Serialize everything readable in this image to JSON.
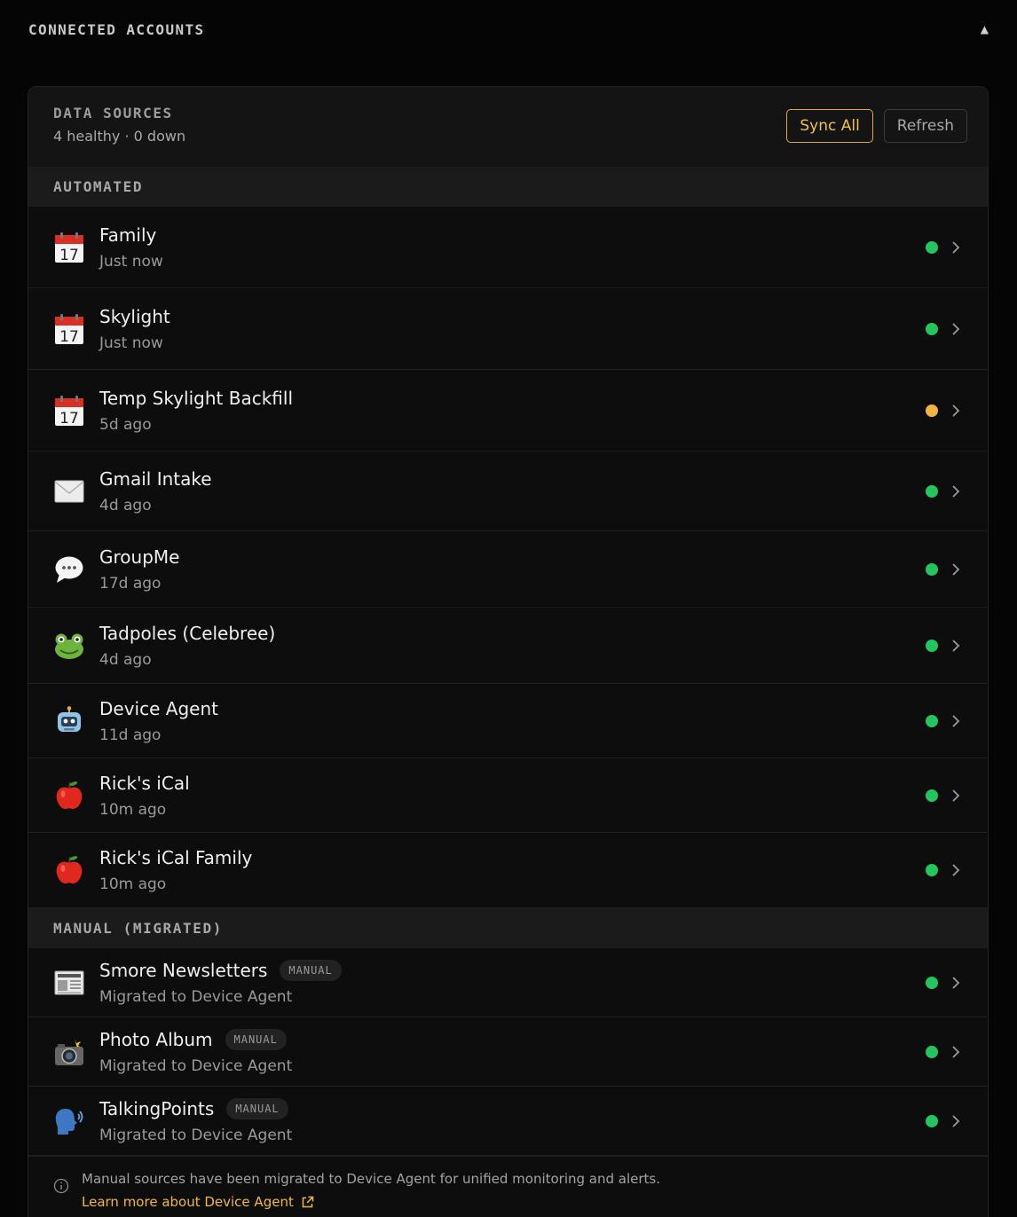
{
  "section": {
    "title": "CONNECTED ACCOUNTS",
    "caret": "▲"
  },
  "card": {
    "title": "DATA SOURCES",
    "status_summary": "4 healthy · 0 down",
    "sync_all_label": "Sync All",
    "refresh_label": "Refresh"
  },
  "colors": {
    "healthy": "#22c55e",
    "warning": "#f2b441",
    "accent": "#f0b93a"
  },
  "groups": {
    "automated_label": "AUTOMATED",
    "manual_label": "MANUAL (MIGRATED)"
  },
  "automated": [
    {
      "name": "Family",
      "meta": "Just now",
      "icon": "calendar-icon",
      "status": "healthy"
    },
    {
      "name": "Skylight",
      "meta": "Just now",
      "icon": "calendar-icon",
      "status": "healthy"
    },
    {
      "name": "Temp Skylight Backfill",
      "meta": "5d ago",
      "icon": "calendar-icon",
      "status": "warning"
    },
    {
      "name": "Gmail Intake",
      "meta": "4d ago",
      "icon": "envelope-icon",
      "status": "healthy"
    },
    {
      "name": "GroupMe",
      "meta": "17d ago",
      "icon": "speech-bubble-icon",
      "status": "healthy"
    },
    {
      "name": "Tadpoles (Celebree)",
      "meta": "4d ago",
      "icon": "frog-icon",
      "status": "healthy"
    },
    {
      "name": "Device Agent",
      "meta": "11d ago",
      "icon": "robot-icon",
      "status": "healthy"
    },
    {
      "name": "Rick's iCal",
      "meta": "10m ago",
      "icon": "apple-icon",
      "status": "healthy"
    },
    {
      "name": "Rick's iCal Family",
      "meta": "10m ago",
      "icon": "apple-icon",
      "status": "healthy"
    }
  ],
  "manual": [
    {
      "name": "Smore Newsletters",
      "badge": "MANUAL",
      "meta": "Migrated to Device Agent",
      "icon": "newspaper-icon",
      "status": "healthy"
    },
    {
      "name": "Photo Album",
      "badge": "MANUAL",
      "meta": "Migrated to Device Agent",
      "icon": "camera-flash-icon",
      "status": "healthy"
    },
    {
      "name": "TalkingPoints",
      "badge": "MANUAL",
      "meta": "Migrated to Device Agent",
      "icon": "speaking-head-icon",
      "status": "healthy"
    }
  ],
  "footer": {
    "info": "Manual sources have been migrated to Device Agent for unified monitoring and alerts.",
    "link": "Learn more about Device Agent"
  }
}
